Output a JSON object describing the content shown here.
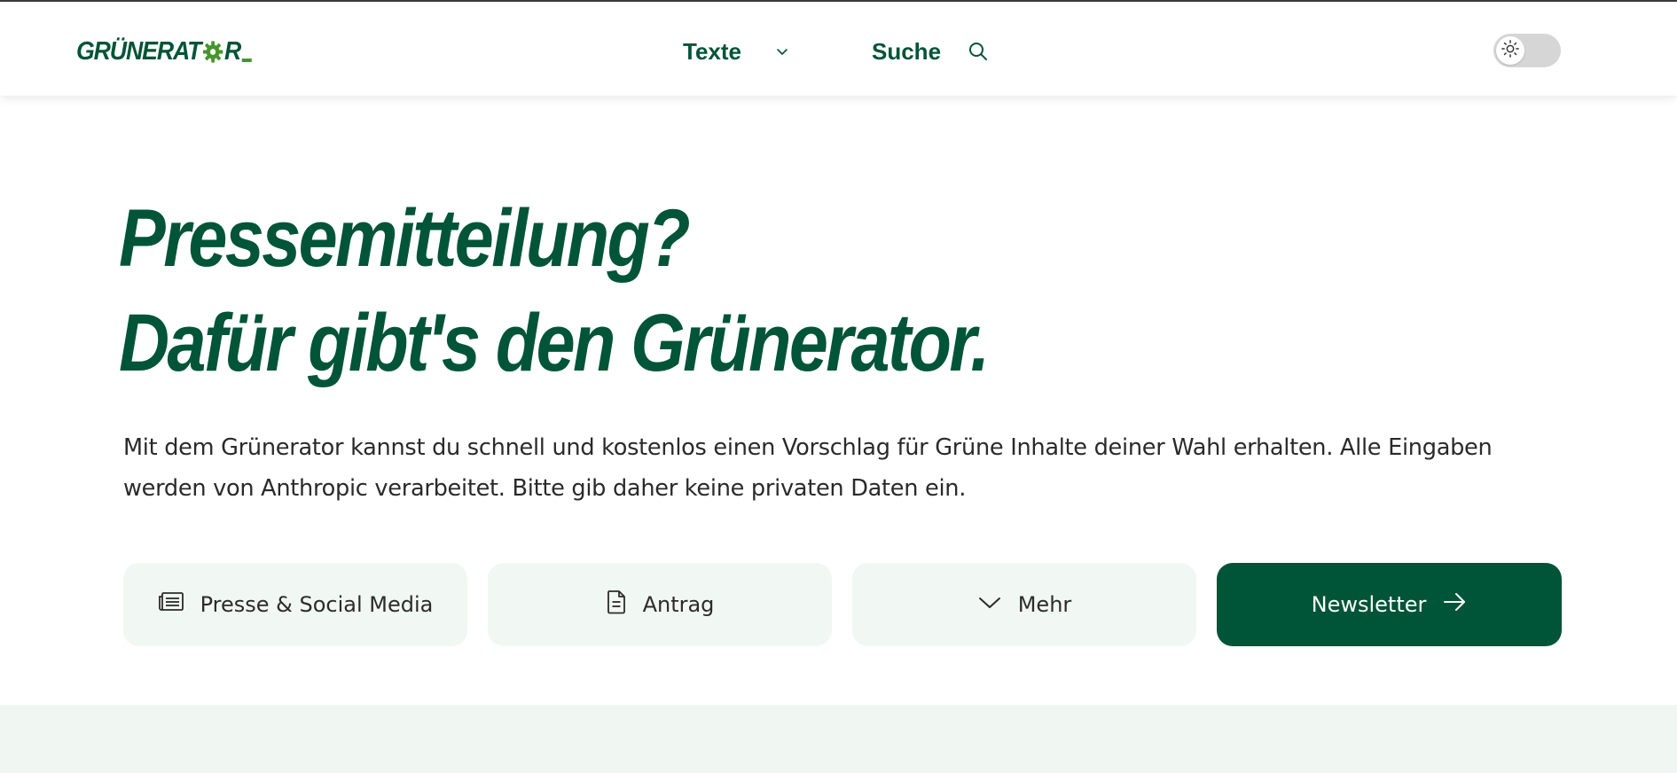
{
  "header": {
    "logo_text_left": "GRÜNERAT",
    "logo_text_right": "R",
    "nav": [
      {
        "label": "Texte",
        "icon": "chevron-down-icon"
      },
      {
        "label": "Suche",
        "icon": "search-icon"
      }
    ],
    "theme_toggle": {
      "state": "light",
      "icon": "sun-icon"
    }
  },
  "hero": {
    "title_line1": "Pressemitteilung?",
    "title_line2": "Dafür gibt's den Grünerator.",
    "intro": "Mit dem Grünerator kannst du schnell und kostenlos einen Vorschlag für Grüne Inhalte deiner Wahl erhalten. Alle Eingaben werden von Anthropic verarbeitet. Bitte gib daher keine privaten Daten ein."
  },
  "buttons": [
    {
      "label": "Presse & Social Media",
      "icon": "newspaper-icon"
    },
    {
      "label": "Antrag",
      "icon": "document-icon"
    },
    {
      "label": "Mehr",
      "icon": "chevron-down-icon"
    },
    {
      "label": "Newsletter",
      "icon": "arrow-right-icon"
    }
  ],
  "colors": {
    "brand": "#005437",
    "accent": "#46962b",
    "button_bg": "#f1f7f3",
    "band_bg": "#f0f7f2"
  }
}
